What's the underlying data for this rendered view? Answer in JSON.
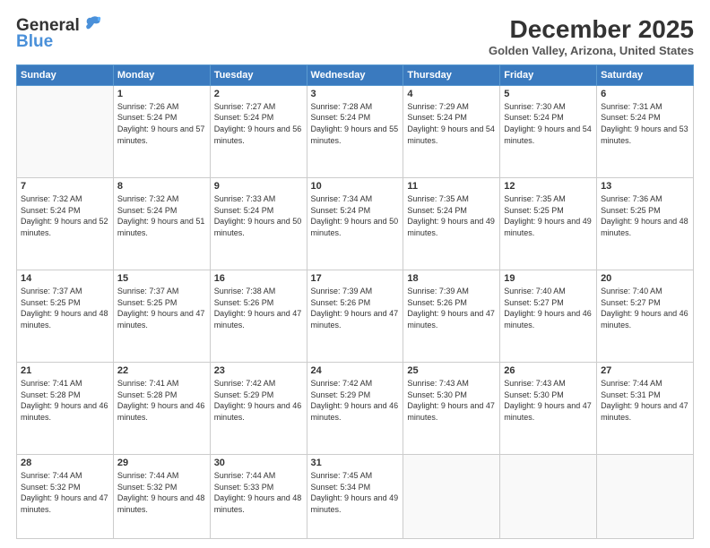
{
  "app": {
    "name_general": "General",
    "name_blue": "Blue"
  },
  "header": {
    "month": "December 2025",
    "location": "Golden Valley, Arizona, United States"
  },
  "days_of_week": [
    "Sunday",
    "Monday",
    "Tuesday",
    "Wednesday",
    "Thursday",
    "Friday",
    "Saturday"
  ],
  "weeks": [
    [
      {
        "num": "",
        "empty": true
      },
      {
        "num": "1",
        "rise": "7:26 AM",
        "set": "5:24 PM",
        "daylight": "9 hours and 57 minutes."
      },
      {
        "num": "2",
        "rise": "7:27 AM",
        "set": "5:24 PM",
        "daylight": "9 hours and 56 minutes."
      },
      {
        "num": "3",
        "rise": "7:28 AM",
        "set": "5:24 PM",
        "daylight": "9 hours and 55 minutes."
      },
      {
        "num": "4",
        "rise": "7:29 AM",
        "set": "5:24 PM",
        "daylight": "9 hours and 54 minutes."
      },
      {
        "num": "5",
        "rise": "7:30 AM",
        "set": "5:24 PM",
        "daylight": "9 hours and 54 minutes."
      },
      {
        "num": "6",
        "rise": "7:31 AM",
        "set": "5:24 PM",
        "daylight": "9 hours and 53 minutes."
      }
    ],
    [
      {
        "num": "7",
        "rise": "7:32 AM",
        "set": "5:24 PM",
        "daylight": "9 hours and 52 minutes."
      },
      {
        "num": "8",
        "rise": "7:32 AM",
        "set": "5:24 PM",
        "daylight": "9 hours and 51 minutes."
      },
      {
        "num": "9",
        "rise": "7:33 AM",
        "set": "5:24 PM",
        "daylight": "9 hours and 50 minutes."
      },
      {
        "num": "10",
        "rise": "7:34 AM",
        "set": "5:24 PM",
        "daylight": "9 hours and 50 minutes."
      },
      {
        "num": "11",
        "rise": "7:35 AM",
        "set": "5:24 PM",
        "daylight": "9 hours and 49 minutes."
      },
      {
        "num": "12",
        "rise": "7:35 AM",
        "set": "5:25 PM",
        "daylight": "9 hours and 49 minutes."
      },
      {
        "num": "13",
        "rise": "7:36 AM",
        "set": "5:25 PM",
        "daylight": "9 hours and 48 minutes."
      }
    ],
    [
      {
        "num": "14",
        "rise": "7:37 AM",
        "set": "5:25 PM",
        "daylight": "9 hours and 48 minutes."
      },
      {
        "num": "15",
        "rise": "7:37 AM",
        "set": "5:25 PM",
        "daylight": "9 hours and 47 minutes."
      },
      {
        "num": "16",
        "rise": "7:38 AM",
        "set": "5:26 PM",
        "daylight": "9 hours and 47 minutes."
      },
      {
        "num": "17",
        "rise": "7:39 AM",
        "set": "5:26 PM",
        "daylight": "9 hours and 47 minutes."
      },
      {
        "num": "18",
        "rise": "7:39 AM",
        "set": "5:26 PM",
        "daylight": "9 hours and 47 minutes."
      },
      {
        "num": "19",
        "rise": "7:40 AM",
        "set": "5:27 PM",
        "daylight": "9 hours and 46 minutes."
      },
      {
        "num": "20",
        "rise": "7:40 AM",
        "set": "5:27 PM",
        "daylight": "9 hours and 46 minutes."
      }
    ],
    [
      {
        "num": "21",
        "rise": "7:41 AM",
        "set": "5:28 PM",
        "daylight": "9 hours and 46 minutes."
      },
      {
        "num": "22",
        "rise": "7:41 AM",
        "set": "5:28 PM",
        "daylight": "9 hours and 46 minutes."
      },
      {
        "num": "23",
        "rise": "7:42 AM",
        "set": "5:29 PM",
        "daylight": "9 hours and 46 minutes."
      },
      {
        "num": "24",
        "rise": "7:42 AM",
        "set": "5:29 PM",
        "daylight": "9 hours and 46 minutes."
      },
      {
        "num": "25",
        "rise": "7:43 AM",
        "set": "5:30 PM",
        "daylight": "9 hours and 47 minutes."
      },
      {
        "num": "26",
        "rise": "7:43 AM",
        "set": "5:30 PM",
        "daylight": "9 hours and 47 minutes."
      },
      {
        "num": "27",
        "rise": "7:44 AM",
        "set": "5:31 PM",
        "daylight": "9 hours and 47 minutes."
      }
    ],
    [
      {
        "num": "28",
        "rise": "7:44 AM",
        "set": "5:32 PM",
        "daylight": "9 hours and 47 minutes."
      },
      {
        "num": "29",
        "rise": "7:44 AM",
        "set": "5:32 PM",
        "daylight": "9 hours and 48 minutes."
      },
      {
        "num": "30",
        "rise": "7:44 AM",
        "set": "5:33 PM",
        "daylight": "9 hours and 48 minutes."
      },
      {
        "num": "31",
        "rise": "7:45 AM",
        "set": "5:34 PM",
        "daylight": "9 hours and 49 minutes."
      },
      {
        "num": "",
        "empty": true
      },
      {
        "num": "",
        "empty": true
      },
      {
        "num": "",
        "empty": true
      }
    ]
  ],
  "labels": {
    "sunrise": "Sunrise:",
    "sunset": "Sunset:",
    "daylight": "Daylight:"
  }
}
